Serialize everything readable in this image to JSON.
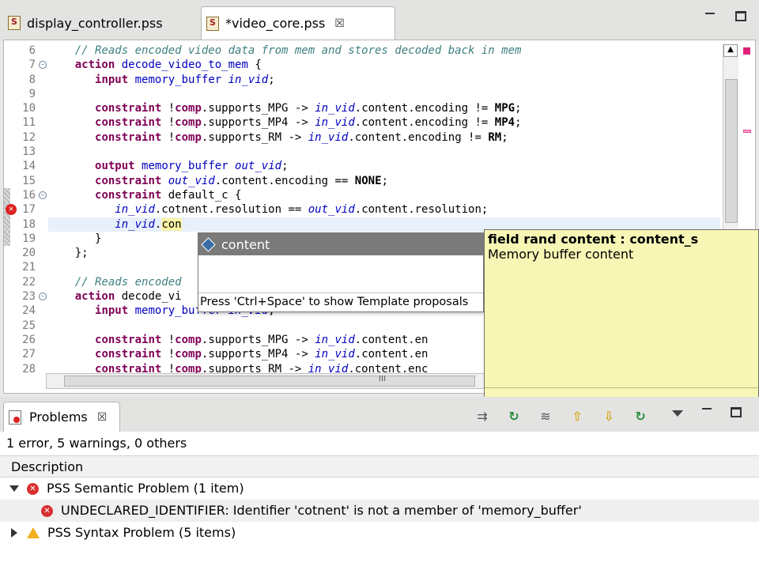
{
  "editor_tabs": [
    {
      "label": "display_controller.pss",
      "icon": "pss-file-icon",
      "active": false
    },
    {
      "label": "*video_core.pss",
      "icon": "pss-file-error-icon",
      "active": true,
      "close": "☒"
    }
  ],
  "editor": {
    "line_numbers": [
      "6",
      "7",
      "8",
      "9",
      "10",
      "11",
      "12",
      "13",
      "14",
      "15",
      "16",
      "17",
      "18",
      "19",
      "20",
      "21",
      "22",
      "23",
      "24",
      "25",
      "26",
      "27",
      "28"
    ],
    "lines": [
      "    // Reads encoded video data from mem and stores decoded back in mem",
      "    action decode_video_to_mem {",
      "       input memory_buffer in_vid;",
      "",
      "       constraint !comp.supports_MPG -> in_vid.content.encoding != MPG;",
      "       constraint !comp.supports_MP4 -> in_vid.content.encoding != MP4;",
      "       constraint !comp.supports_RM -> in_vid.content.encoding != RM;",
      "",
      "       output memory_buffer out_vid;",
      "       constraint out_vid.content.encoding == NONE;",
      "       constraint default_c {",
      "          in_vid.cotnent.resolution == out_vid.content.resolution;",
      "          in_vid.",
      "       }",
      "    };",
      "",
      "    // Reads encoded",
      "    action decode_vi",
      "       input memory_buffer in_vid;",
      "",
      "       constraint !comp.supports_MPG -> in_vid.content.en",
      "       constraint !comp.supports_MP4 -> in_vid.content.en",
      "       constraint !comp.supports_RM -> in_vid.content.enc"
    ],
    "cursor_completion": "con",
    "hscroll_label": "III"
  },
  "content_assist": {
    "proposal": "content",
    "hint": "Press 'Ctrl+Space' to show Template proposals"
  },
  "tooltip": {
    "title": "field rand content : content_s",
    "body": "Memory buffer content"
  },
  "problems": {
    "tab_label": "Problems",
    "tab_close": "☒",
    "summary": "1 error, 5 warnings, 0 others",
    "column_description": "Description",
    "groups": [
      {
        "label": "PSS Semantic Problem (1 item)",
        "expanded": true,
        "severity": "error",
        "items": [
          "UNDECLARED_IDENTIFIER: Identifier 'cotnent' is not a member of 'memory_buffer'"
        ]
      },
      {
        "label": "PSS Syntax Problem (5 items)",
        "expanded": false,
        "severity": "warning",
        "items": []
      }
    ]
  },
  "colors": {
    "keyword": "#7f0055",
    "field": "#0000c0",
    "comment": "#3f7f7f",
    "error": "#d83030",
    "warning": "#f0b020",
    "tooltip_bg": "#f8f6b5"
  }
}
